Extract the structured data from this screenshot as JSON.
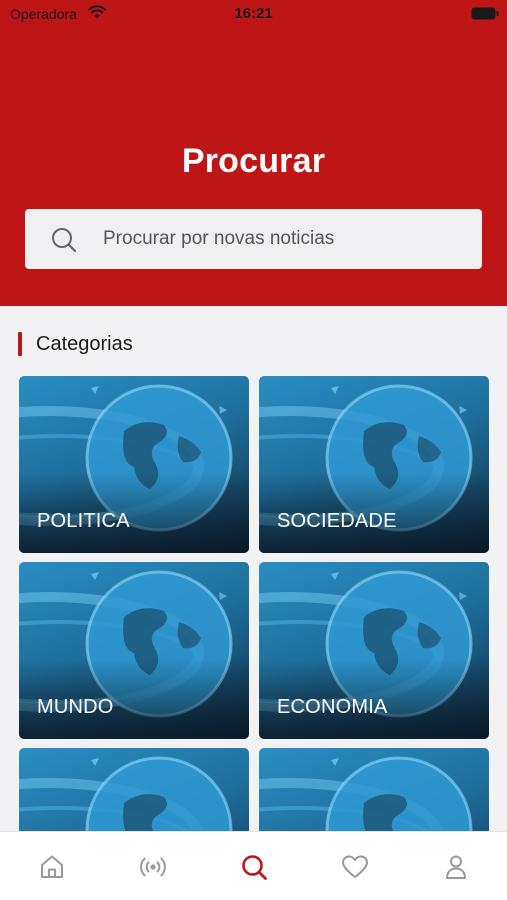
{
  "status_bar": {
    "carrier": "Operadora",
    "time": "16:21"
  },
  "header": {
    "title": "Procurar"
  },
  "search": {
    "placeholder": "Procurar por novas noticias"
  },
  "categories_section": {
    "title": "Categorias"
  },
  "categories": [
    {
      "label": "POLITICA"
    },
    {
      "label": "SOCIEDADE"
    },
    {
      "label": "MUNDO"
    },
    {
      "label": "ECONOMIA"
    },
    {
      "label": ""
    },
    {
      "label": ""
    }
  ],
  "tab_bar": {
    "items": [
      {
        "icon": "home-icon",
        "active": false
      },
      {
        "icon": "broadcast-icon",
        "active": false
      },
      {
        "icon": "search-icon",
        "active": true
      },
      {
        "icon": "heart-icon",
        "active": false
      },
      {
        "icon": "user-icon",
        "active": false
      }
    ]
  },
  "colors": {
    "brand_red": "#be1616",
    "tab_inactive": "#9a9a9e",
    "background": "#f2f2f4"
  }
}
